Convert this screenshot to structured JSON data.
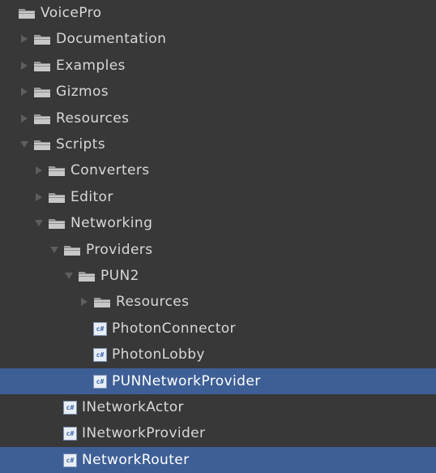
{
  "tree": {
    "items": [
      {
        "label": "VoicePro",
        "depth": 0,
        "type": "folder",
        "expand": "none",
        "selected": false
      },
      {
        "label": "Documentation",
        "depth": 1,
        "type": "folder",
        "expand": "collapsed",
        "selected": false
      },
      {
        "label": "Examples",
        "depth": 1,
        "type": "folder",
        "expand": "collapsed",
        "selected": false
      },
      {
        "label": "Gizmos",
        "depth": 1,
        "type": "folder",
        "expand": "collapsed",
        "selected": false
      },
      {
        "label": "Resources",
        "depth": 1,
        "type": "folder",
        "expand": "collapsed",
        "selected": false
      },
      {
        "label": "Scripts",
        "depth": 1,
        "type": "folder",
        "expand": "expanded",
        "selected": false
      },
      {
        "label": "Converters",
        "depth": 2,
        "type": "folder",
        "expand": "collapsed",
        "selected": false
      },
      {
        "label": "Editor",
        "depth": 2,
        "type": "folder",
        "expand": "collapsed",
        "selected": false
      },
      {
        "label": "Networking",
        "depth": 2,
        "type": "folder",
        "expand": "expanded",
        "selected": false
      },
      {
        "label": "Providers",
        "depth": 3,
        "type": "folder",
        "expand": "expanded",
        "selected": false
      },
      {
        "label": "PUN2",
        "depth": 4,
        "type": "folder",
        "expand": "expanded",
        "selected": false
      },
      {
        "label": "Resources",
        "depth": 5,
        "type": "folder",
        "expand": "collapsed",
        "selected": false
      },
      {
        "label": "PhotonConnector",
        "depth": 5,
        "type": "script",
        "expand": "none",
        "selected": false
      },
      {
        "label": "PhotonLobby",
        "depth": 5,
        "type": "script",
        "expand": "none",
        "selected": false
      },
      {
        "label": "PUNNetworkProvider",
        "depth": 5,
        "type": "script",
        "expand": "none",
        "selected": true
      },
      {
        "label": "INetworkActor",
        "depth": 3,
        "type": "script",
        "expand": "none",
        "selected": false
      },
      {
        "label": "INetworkProvider",
        "depth": 3,
        "type": "script",
        "expand": "none",
        "selected": false
      },
      {
        "label": "NetworkRouter",
        "depth": 3,
        "type": "script",
        "expand": "none",
        "selected": true
      }
    ],
    "script_badge": "c#",
    "colors": {
      "background": "#383838",
      "selection": "#3e5f96",
      "text": "#d8d8d8"
    }
  }
}
